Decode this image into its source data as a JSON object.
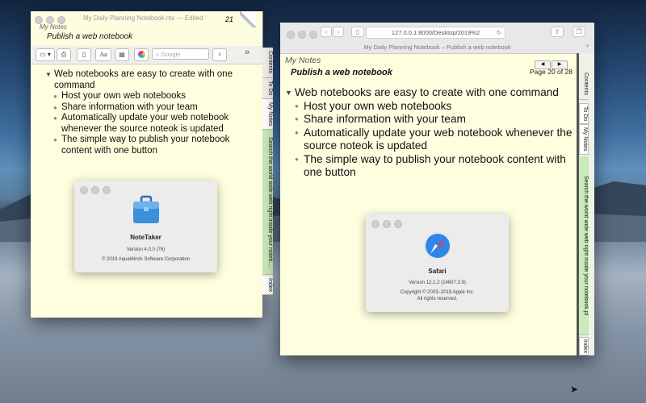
{
  "notetaker": {
    "title": "My Daily Planning Notebook.ntx — Edited",
    "page_number": "21",
    "notebook_name": "My Notes",
    "page_title": "Publish a web notebook",
    "search_placeholder": "Google",
    "font_button": "Aa",
    "expand_label": "»",
    "tabs": [
      "Contents",
      "To Do",
      "My Notes",
      "Search the world wide web right inside your noteb…",
      "Index"
    ]
  },
  "content": {
    "heading": "Web notebooks are easy to create with one command",
    "items": [
      "Host your own web notebooks",
      "Share information with your team",
      "Automatically update your web notebook whenever the source noteok is updated",
      "The simple way to publish your notebook content with one button"
    ]
  },
  "safari": {
    "url": "127.0.0.1:8000/Desktop/2019%2",
    "tab_title": "My Daily Planning Notebook – Publish a web notebook",
    "notebook_name": "My Notes",
    "page_title": "Publish a web notebook",
    "page_indicator": "Page 20 of 28",
    "tabs": [
      "Contents",
      "To Do",
      "My Notes",
      "Search the world wide web right inside your notebook.pl",
      "Index"
    ]
  },
  "about_notetaker": {
    "name": "NoteTaker",
    "version": "Version 4.0.0 (76)",
    "copyright": "© 2019 AquaMinds Software Corporation"
  },
  "about_safari": {
    "name": "Safari",
    "version": "Version 12.1.2 (14607.3.9)",
    "copyright": "Copyright © 2003–2019 Apple Inc.",
    "rights": "All rights reserved."
  },
  "colors": {
    "note_paper": "#ffffe0",
    "tab_highlight": "#c9eab9",
    "safari_blue": "#2f86e8"
  }
}
